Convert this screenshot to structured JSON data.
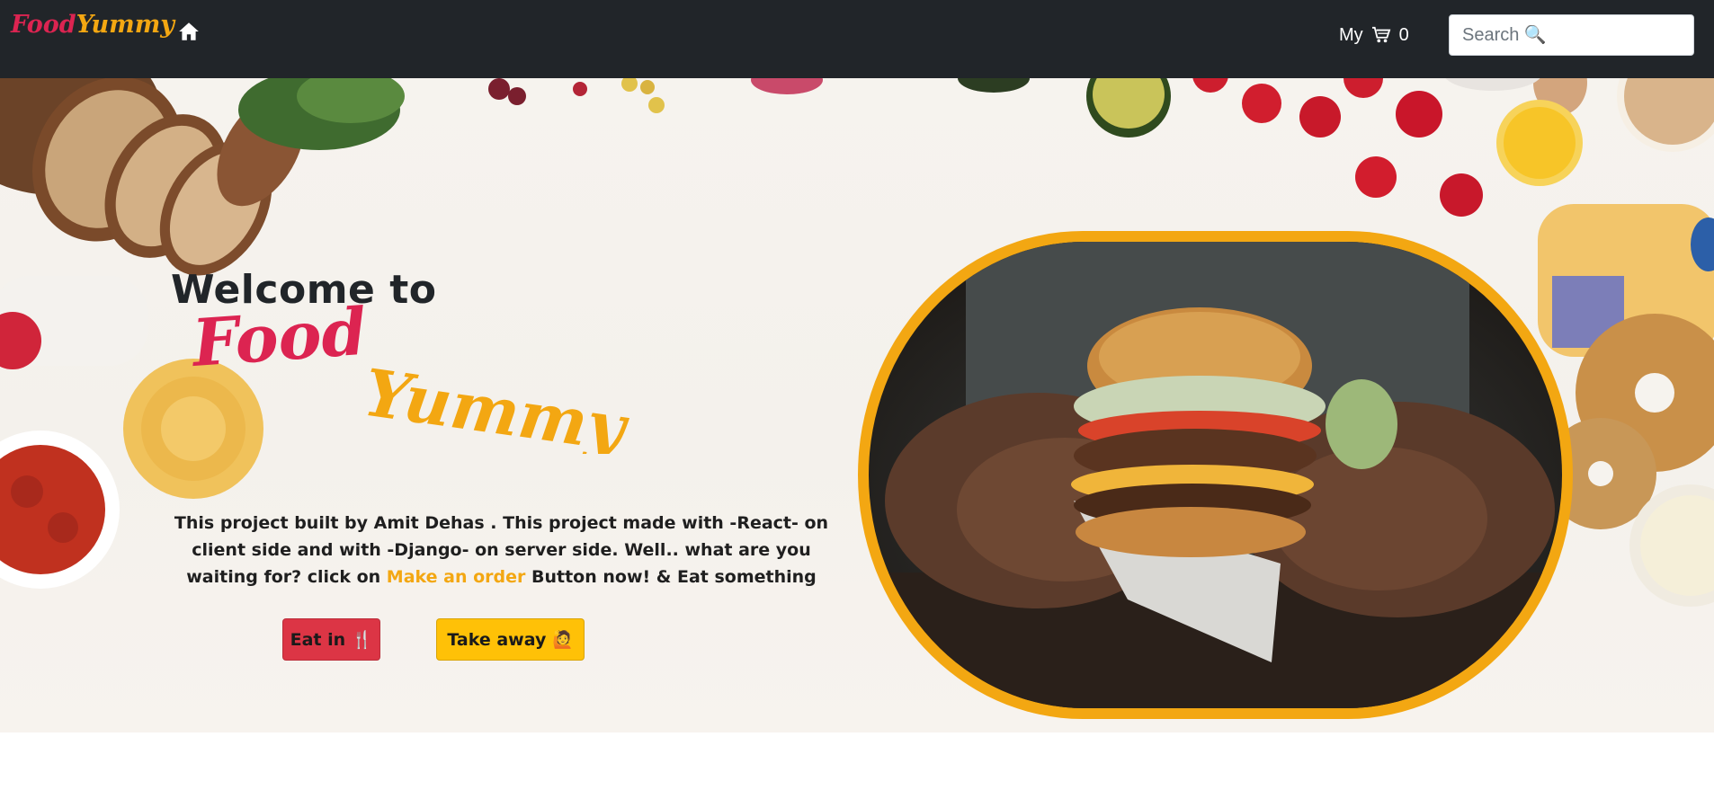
{
  "navbar": {
    "brand_part1": "Food",
    "brand_part2": "Yummy",
    "home_icon": "home-icon",
    "cart_label": "My",
    "cart_icon": "cart-icon",
    "cart_count": "0",
    "search_placeholder": "Search 🔍"
  },
  "hero": {
    "welcome": "Welcome to",
    "logo_part1": "Food",
    "logo_part2": "Yummy",
    "description_before": "This project built by Amit Dehas . This project made with -React- on client side and with -Django- on server side. Well.. what are you waiting for? click on ",
    "description_link": "Make an order",
    "description_after": " Button now! & Eat something",
    "eat_in_label": "Eat in 🍴",
    "take_away_label": "Take away 🙋",
    "image_frame_color": "#f3a712"
  },
  "colors": {
    "navbar_bg": "#212529",
    "brand_red": "#dc2451",
    "brand_yellow": "#f3a712",
    "eat_in_btn": "#dc3545",
    "take_away_btn": "#ffc107"
  }
}
